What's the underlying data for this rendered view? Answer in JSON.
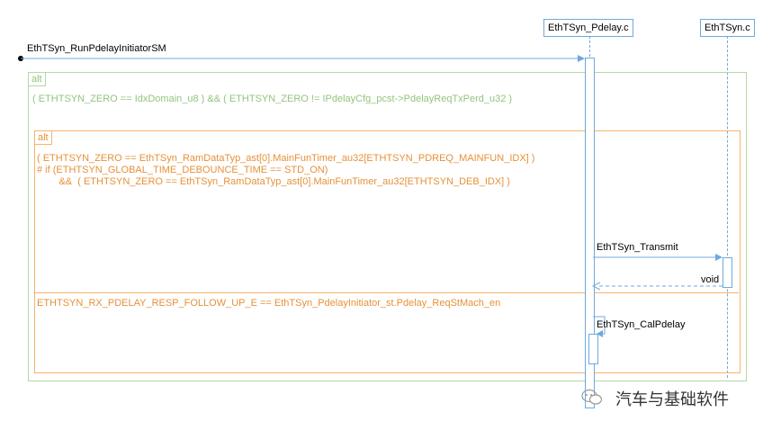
{
  "lifelines": {
    "pdelay": {
      "label": "EthTSyn_Pdelay.c"
    },
    "ethtsyn": {
      "label": "EthTSyn.c"
    }
  },
  "messages": {
    "found_call": "EthTSyn_RunPdelayInitiatorSM",
    "transmit": "EthTSyn_Transmit",
    "transmit_return": "void",
    "self_call": "EthTSyn_CalPdelay"
  },
  "outer_frame": {
    "tag": "alt",
    "condition": "( ETHTSYN_ZERO == IdxDomain_u8 ) && ( ETHTSYN_ZERO != IPdelayCfg_pcst->PdelayReqTxPerd_u32 )"
  },
  "inner_frame": {
    "tag": "alt",
    "condition_line1": "( ETHTSYN_ZERO == EthTSyn_RamDataTyp_ast[0].MainFunTimer_au32[ETHTSYN_PDREQ_MAINFUN_IDX] )",
    "condition_line2": "# if (ETHTSYN_GLOBAL_TIME_DEBOUNCE_TIME == STD_ON)",
    "condition_line3": "        &&  ( ETHTSYN_ZERO == EthTSyn_RamDataTyp_ast[0].MainFunTimer_au32[ETHTSYN_DEB_IDX] )",
    "else_condition": "ETHTSYN_RX_PDELAY_RESP_FOLLOW_UP_E == EthTSyn_PdelayInitiator_st.Pdelay_ReqStMach_en"
  },
  "watermark": {
    "text": "汽车与基础软件"
  },
  "colors": {
    "lifeline": "#6fa8dc",
    "outer_frame": "#b6d7a8",
    "outer_text": "#93c47d",
    "inner_frame": "#f6b26b",
    "inner_text": "#e69138"
  }
}
